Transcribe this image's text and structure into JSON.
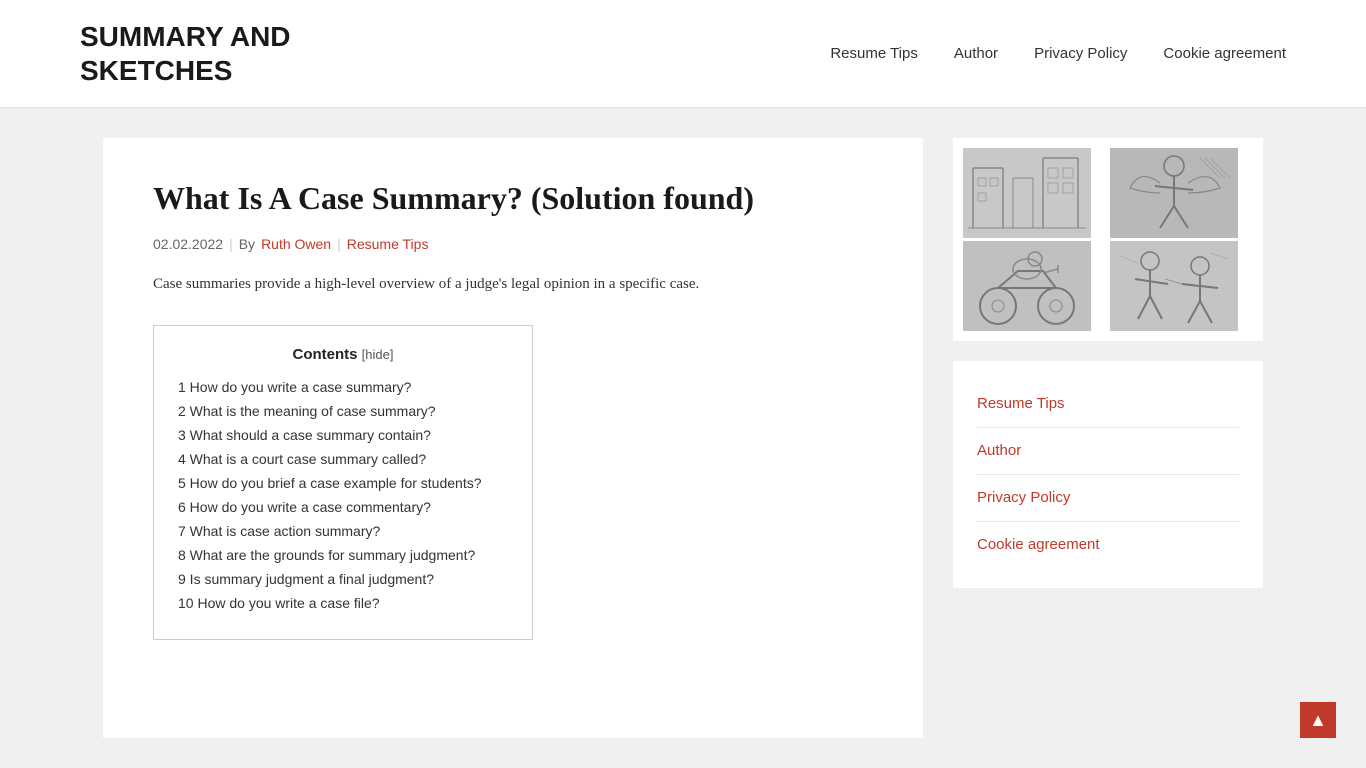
{
  "site": {
    "title": "SUMMARY AND SKETCHES"
  },
  "nav": {
    "items": [
      {
        "label": "Resume Tips",
        "href": "#"
      },
      {
        "label": "Author",
        "href": "#"
      },
      {
        "label": "Privacy Policy",
        "href": "#"
      },
      {
        "label": "Cookie agreement",
        "href": "#"
      }
    ]
  },
  "article": {
    "title": "What Is A Case Summary? (Solution found)",
    "date": "02.02.2022",
    "by_label": "By",
    "author": "Ruth Owen",
    "separator": "|",
    "category": "Resume Tips",
    "intro": "Case summaries provide a high-level overview of a judge's legal opinion in a specific case."
  },
  "toc": {
    "title": "Contents",
    "hide_label": "[hide]",
    "items": [
      {
        "number": "1",
        "label": "How do you write a case summary?"
      },
      {
        "number": "2",
        "label": "What is the meaning of case summary?"
      },
      {
        "number": "3",
        "label": "What should a case summary contain?"
      },
      {
        "number": "4",
        "label": "What is a court case summary called?"
      },
      {
        "number": "5",
        "label": "How do you brief a case example for students?"
      },
      {
        "number": "6",
        "label": "How do you write a case commentary?"
      },
      {
        "number": "7",
        "label": "What is case action summary?"
      },
      {
        "number": "8",
        "label": "What are the grounds for summary judgment?"
      },
      {
        "number": "9",
        "label": "Is summary judgment a final judgment?"
      },
      {
        "number": "10",
        "label": "How do you write a case file?"
      }
    ]
  },
  "sidebar": {
    "nav_items": [
      {
        "label": "Resume Tips",
        "href": "#"
      },
      {
        "label": "Author",
        "href": "#"
      },
      {
        "label": "Privacy Policy",
        "href": "#"
      },
      {
        "label": "Cookie agreement",
        "href": "#"
      }
    ]
  },
  "scroll_top": {
    "icon": "▲"
  }
}
